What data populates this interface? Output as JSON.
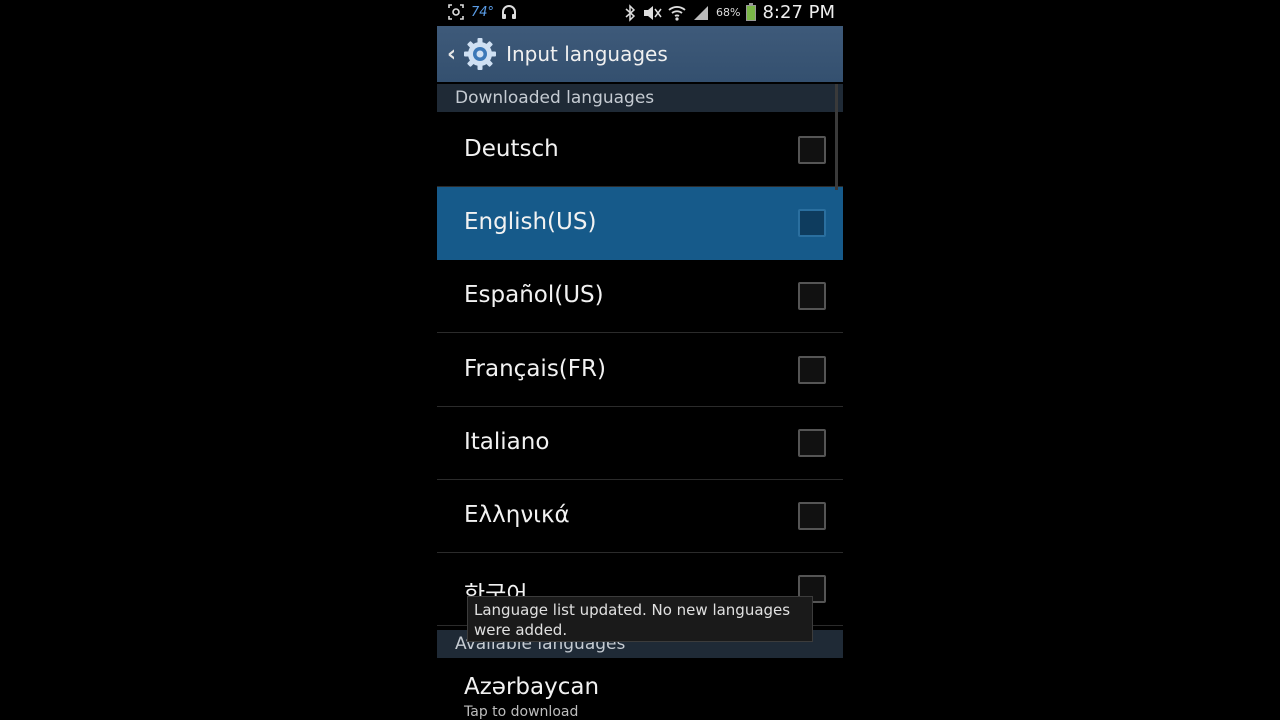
{
  "status_bar": {
    "temperature": "74°",
    "battery_percent": "68%",
    "time": "8:27 PM",
    "icons": [
      "screenshot-icon",
      "headphones-icon",
      "bluetooth-icon",
      "mute-icon",
      "wifi-icon",
      "signal-icon",
      "battery-icon"
    ]
  },
  "action_bar": {
    "title": "Input languages",
    "back_icon": "chevron-left-icon",
    "app_icon": "gear-icon"
  },
  "downloaded_section": {
    "header": "Downloaded languages",
    "items": [
      {
        "label": "Deutsch",
        "checked": false,
        "selected": false
      },
      {
        "label": "English(US)",
        "checked": false,
        "selected": true
      },
      {
        "label": "Español(US)",
        "checked": false,
        "selected": false
      },
      {
        "label": "Français(FR)",
        "checked": false,
        "selected": false
      },
      {
        "label": "Italiano",
        "checked": false,
        "selected": false
      },
      {
        "label": "Ελληνικά",
        "checked": false,
        "selected": false
      },
      {
        "label": "한국어",
        "checked": false,
        "selected": false
      }
    ]
  },
  "available_section": {
    "header": "Available languages",
    "items": [
      {
        "label": "Azərbaycan",
        "subtitle": "Tap to download"
      }
    ]
  },
  "toast": {
    "message": "Language list updated. No new languages were added."
  },
  "colors": {
    "action_bar": "#3e5a7a",
    "selected_row": "#165a8a",
    "temperature": "#5a9ce6",
    "battery": "#7ab648"
  }
}
